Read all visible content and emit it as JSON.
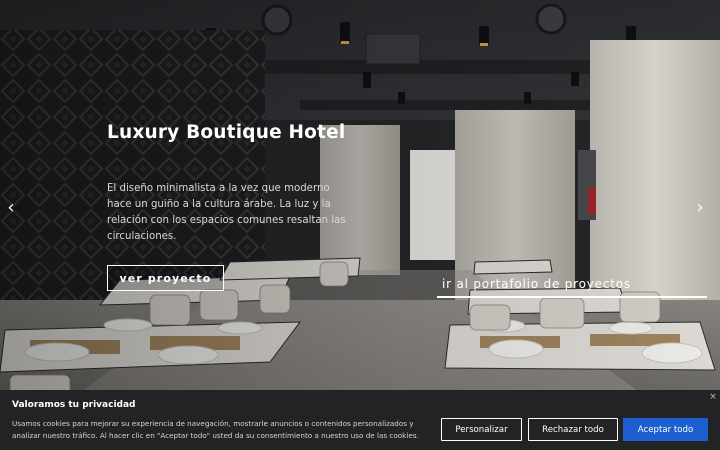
{
  "hero": {
    "title": "Luxury Boutique Hotel",
    "description": "El diseño minimalista a la vez que moderno hace un guiño a la cultura árabe. La luz y la relación con los espacios comunes resaltan las circulaciones.",
    "project_button": "ver proyecto",
    "portfolio_link": "ir al portafolio de proyectos",
    "prev_arrow": "‹",
    "next_arrow": "›",
    "background_image": "restaurant-interior-photo"
  },
  "cookie_banner": {
    "title": "Valoramos tu privacidad",
    "text": "Usamos cookies para mejorar su experiencia de navegación, mostrarle anuncios o contenidos personalizados y analizar nuestro tráfico. Al hacer clic en \"Aceptar todo\" usted da su consentimiento a nuestro uso de las cookies.",
    "customize_label": "Personalizar",
    "reject_label": "Rechazar todo",
    "accept_label": "Aceptar todo",
    "close_label": "×",
    "accent_color": "#1d5fd1"
  }
}
